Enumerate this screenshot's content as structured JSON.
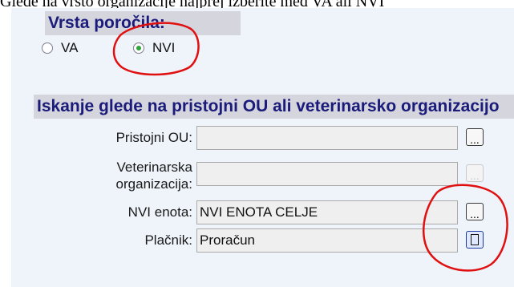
{
  "header_text": "Glede na vrsto organizacije najprej izberite med VA ali NVI",
  "report_type": {
    "title": "Vrsta poročila:",
    "options": [
      {
        "label": "VA",
        "checked": false
      },
      {
        "label": "NVI",
        "checked": true
      }
    ]
  },
  "search": {
    "title": "Iskanje glede na pristojni OU ali veterinarsko organizacijo",
    "fields": {
      "pristojni_ou": {
        "label": "Pristojni OU:",
        "value": "",
        "button": "..."
      },
      "vet_org": {
        "label_line1": "Veterinarska",
        "label_line2": "organizacija:",
        "value": "",
        "button": "..."
      },
      "nvi_enota": {
        "label": "NVI enota:",
        "value": "NVI ENOTA CELJE",
        "button": "..."
      },
      "placnik": {
        "label": "Plačnik:",
        "value": "Proračun",
        "button": "..."
      }
    }
  },
  "colors": {
    "annotation": "#e01010",
    "header_text": "#1a1b7a",
    "panel_bg": "#eef4fa"
  }
}
